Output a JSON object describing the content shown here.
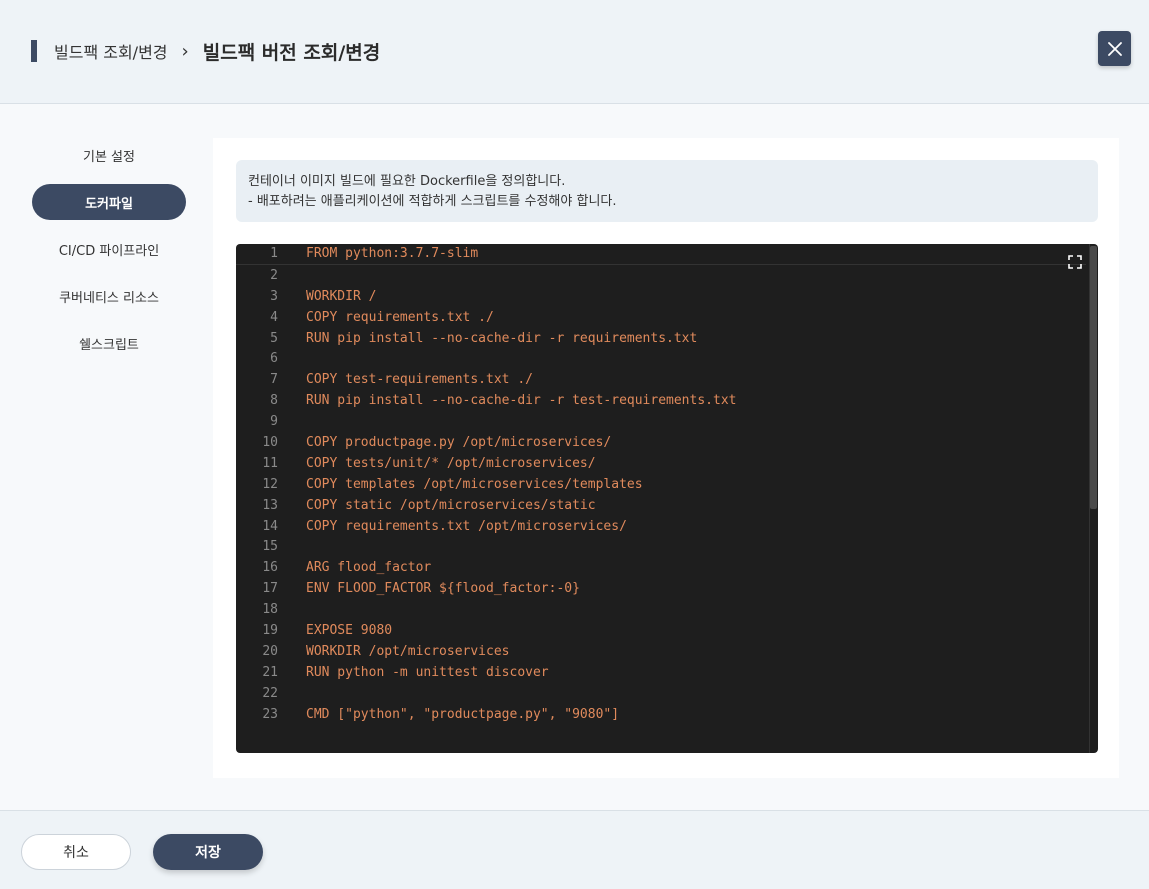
{
  "header": {
    "breadcrumb_parent": "빌드팩 조회/변경",
    "breadcrumb_separator": "›",
    "title": "빌드팩 버전 조회/변경",
    "close_icon": "close-icon"
  },
  "sidebar": {
    "items": [
      {
        "label": "기본 설정",
        "active": false
      },
      {
        "label": "도커파일",
        "active": true
      },
      {
        "label": "CI/CD 파이프라인",
        "active": false
      },
      {
        "label": "쿠버네티스 리소스",
        "active": false
      },
      {
        "label": "쉘스크립트",
        "active": false
      }
    ]
  },
  "notice": {
    "line1": "컨테이너 이미지 빌드에 필요한 Dockerfile을 정의합니다.",
    "line2": "- 배포하려는 애플리케이션에 적합하게 스크립트를 수정해야 합니다."
  },
  "editor": {
    "fullscreen_icon": "fullscreen-icon",
    "lines": [
      "FROM python:3.7.7-slim",
      "",
      "WORKDIR /",
      "COPY requirements.txt ./",
      "RUN pip install --no-cache-dir -r requirements.txt",
      "",
      "COPY test-requirements.txt ./",
      "RUN pip install --no-cache-dir -r test-requirements.txt",
      "",
      "COPY productpage.py /opt/microservices/",
      "COPY tests/unit/* /opt/microservices/",
      "COPY templates /opt/microservices/templates",
      "COPY static /opt/microservices/static",
      "COPY requirements.txt /opt/microservices/",
      "",
      "ARG flood_factor",
      "ENV FLOOD_FACTOR ${flood_factor:-0}",
      "",
      "EXPOSE 9080",
      "WORKDIR /opt/microservices",
      "RUN python -m unittest discover",
      "",
      "CMD [\"python\", \"productpage.py\", \"9080\"]"
    ]
  },
  "footer": {
    "cancel_label": "취소",
    "save_label": "저장"
  },
  "colors": {
    "accent": "#3c4a63",
    "code_text": "#e08a5c",
    "editor_bg": "#1e1e1e"
  }
}
